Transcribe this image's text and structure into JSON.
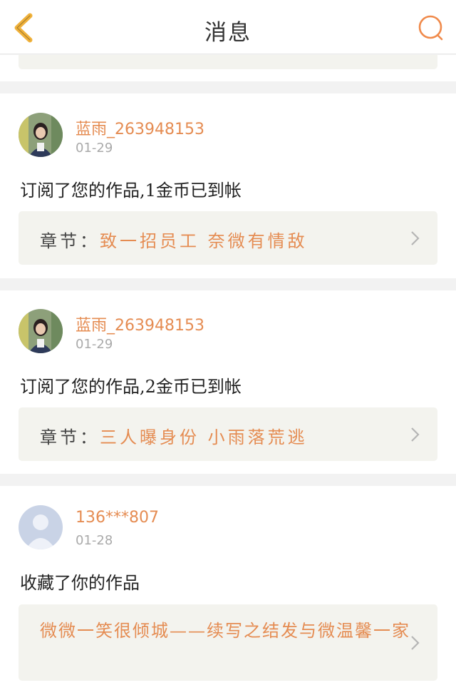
{
  "header": {
    "title": "消息",
    "back_icon": "chevron-left-icon",
    "search_icon": "search-icon",
    "accent": "#f0b13a",
    "search_color": "#f08a4b"
  },
  "colors": {
    "username": "#e58c52",
    "box_bg": "#f3f3ee",
    "page_bg": "#f2f2f2"
  },
  "messages": [
    {
      "username": "蓝雨_263948153",
      "date": "01-29",
      "text": "订阅了您的作品,1金币已到帐",
      "chapter_label": "章节：",
      "chapter_name": "致一招员工  奈微有情敌",
      "avatar": "user-photo-avatar"
    },
    {
      "username": "蓝雨_263948153",
      "date": "01-29",
      "text": "订阅了您的作品,2金币已到帐",
      "chapter_label": "章节：",
      "chapter_name": "三人曝身份  小雨落荒逃",
      "avatar": "user-photo-avatar"
    },
    {
      "username": "136***807",
      "date": "01-28",
      "text": "收藏了你的作品",
      "work_title": "微微一笑很倾城——续写之结发与微温馨一家",
      "avatar": "default-avatar"
    }
  ]
}
